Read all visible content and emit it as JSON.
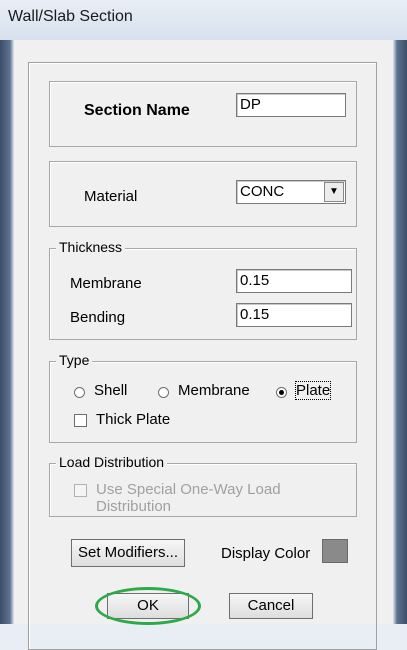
{
  "window": {
    "title": "Wall/Slab Section"
  },
  "section_name": {
    "label": "Section Name",
    "value": "DP"
  },
  "material": {
    "label": "Material",
    "value": "CONC"
  },
  "thickness": {
    "group_label": "Thickness",
    "membrane_label": "Membrane",
    "membrane_value": "0.15",
    "bending_label": "Bending",
    "bending_value": "0.15"
  },
  "type": {
    "group_label": "Type",
    "shell_label": "Shell",
    "membrane_label": "Membrane",
    "plate_label": "Plate",
    "selected": "Plate",
    "thick_plate_label": "Thick Plate",
    "thick_plate_checked": false
  },
  "load_distribution": {
    "group_label": "Load Distribution",
    "checkbox_label": "Use Special One-Way Load Distribution",
    "checked": false,
    "enabled": false
  },
  "buttons": {
    "set_modifiers": "Set Modifiers...",
    "ok": "OK",
    "cancel": "Cancel"
  },
  "display_color": {
    "label": "Display Color",
    "color": "#8a8a8a"
  },
  "colors": {
    "focus_ring": "#2ea94a"
  }
}
